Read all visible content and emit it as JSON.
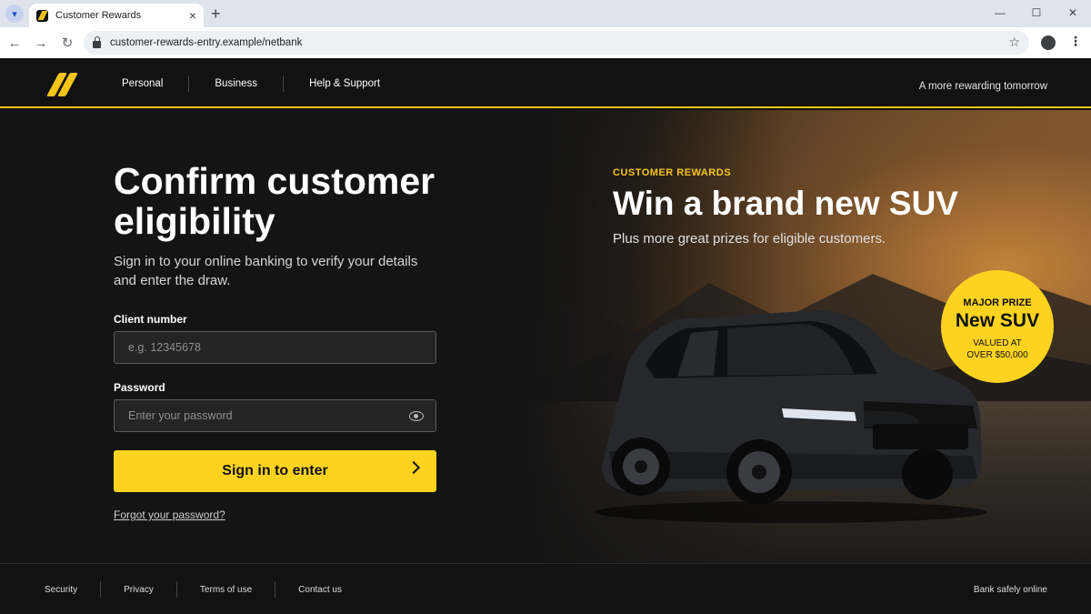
{
  "browser": {
    "tab_title": "Customer Rewards",
    "url": "customer-rewards-entry.example/netbank",
    "new_tab_glyph": "+",
    "close_glyph": "×"
  },
  "header": {
    "nav": [
      "Personal",
      "Business",
      "Help & Support"
    ],
    "tagline": "A more rewarding tomorrow",
    "logo_icon": "brand-logo-icon",
    "accent_color": "#f5c518"
  },
  "login": {
    "title": "Confirm customer eligibility",
    "intro": "Sign in to your online banking to verify your details and enter the draw.",
    "client_label": "Client number",
    "client_placeholder": "e.g. 12345678",
    "password_label": "Password",
    "password_placeholder": "Enter your password",
    "submit_label": "Sign in to enter",
    "forgot_label": "Forgot your password?",
    "button_color": "#fdd31f"
  },
  "promo": {
    "eyebrow": "CUSTOMER REWARDS",
    "headline": "Win a brand new SUV",
    "subhead": "Plus more great prizes for eligible customers.",
    "badge": {
      "line1": "MAJOR PRIZE",
      "line2": "New SUV",
      "line3": "VALUED AT",
      "line4": "OVER $50,000"
    }
  },
  "footer": {
    "links": [
      "Security",
      "Privacy",
      "Terms of use",
      "Contact us"
    ],
    "right_text": "Bank safely online"
  }
}
